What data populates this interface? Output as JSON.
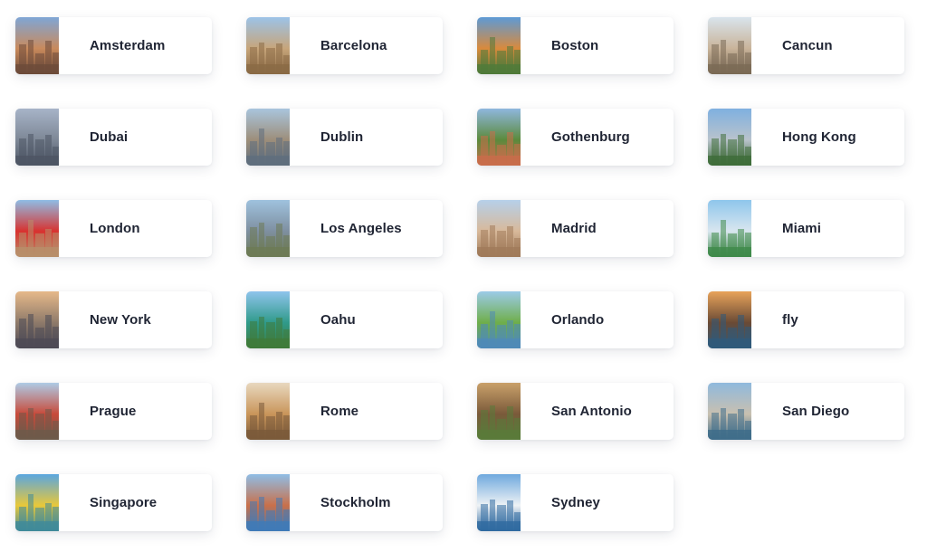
{
  "destinations": [
    {
      "name": "Amsterdam",
      "icon": "amsterdam-photo",
      "colors": [
        "#7fa6d6",
        "#c98a5c",
        "#6d4b3a"
      ]
    },
    {
      "name": "Barcelona",
      "icon": "barcelona-photo",
      "colors": [
        "#9cc3e8",
        "#c7a57a",
        "#8a6a45"
      ]
    },
    {
      "name": "Boston",
      "icon": "boston-photo",
      "colors": [
        "#5d9ad6",
        "#d98a3c",
        "#4f7a3a"
      ]
    },
    {
      "name": "Cancun",
      "icon": "cancun-photo",
      "colors": [
        "#d9e4ec",
        "#c9b49a",
        "#7a6a55"
      ]
    },
    {
      "name": "Dubai",
      "icon": "dubai-photo",
      "colors": [
        "#a7b4c8",
        "#7d8796",
        "#4d5564"
      ]
    },
    {
      "name": "Dublin",
      "icon": "dublin-photo",
      "colors": [
        "#a9c5dd",
        "#9d8e7a",
        "#5f6e7d"
      ]
    },
    {
      "name": "Gothenburg",
      "icon": "gothenburg-photo",
      "colors": [
        "#8fb7de",
        "#5b8a3c",
        "#c96d4b"
      ]
    },
    {
      "name": "Hong Kong",
      "icon": "hong-kong-photo",
      "colors": [
        "#7fb0e0",
        "#b9c3cc",
        "#3f6d3a"
      ]
    },
    {
      "name": "London",
      "icon": "london-photo",
      "colors": [
        "#8fbde6",
        "#d8322f",
        "#b88e6a"
      ]
    },
    {
      "name": "Los Angeles",
      "icon": "los-angeles-photo",
      "colors": [
        "#9fc2de",
        "#7e8fa0",
        "#6d7a55"
      ]
    },
    {
      "name": "Madrid",
      "icon": "madrid-photo",
      "colors": [
        "#b6d0ea",
        "#d8b99a",
        "#a07a5a"
      ]
    },
    {
      "name": "Miami",
      "icon": "miami-photo",
      "colors": [
        "#8ec6ec",
        "#d9e6ef",
        "#3f8a4a"
      ]
    },
    {
      "name": "New York",
      "icon": "new-york-photo",
      "colors": [
        "#e6b98a",
        "#8e7a6a",
        "#4d4a55"
      ]
    },
    {
      "name": "Oahu",
      "icon": "oahu-photo",
      "colors": [
        "#8fc4ec",
        "#2f9a8a",
        "#3f7a3a"
      ]
    },
    {
      "name": "Orlando",
      "icon": "orlando-photo",
      "colors": [
        "#9ccbe8",
        "#6fae4a",
        "#4f8ab8"
      ]
    },
    {
      "name": "fly",
      "icon": "paris-photo",
      "colors": [
        "#e8a35a",
        "#6a4a35",
        "#2f5a7a"
      ]
    },
    {
      "name": "Prague",
      "icon": "prague-photo",
      "colors": [
        "#aecbe6",
        "#c84a3a",
        "#6e5a4a"
      ]
    },
    {
      "name": "Rome",
      "icon": "rome-photo",
      "colors": [
        "#e8d8bf",
        "#c9955a",
        "#7a5a3a"
      ]
    },
    {
      "name": "San Antonio",
      "icon": "san-antonio-photo",
      "colors": [
        "#c9a06a",
        "#7a5a3a",
        "#5a7a3a"
      ]
    },
    {
      "name": "San Diego",
      "icon": "san-diego-photo",
      "colors": [
        "#8fb9dd",
        "#c9c0b0",
        "#3f6d8a"
      ]
    },
    {
      "name": "Singapore",
      "icon": "singapore-photo",
      "colors": [
        "#5aa6e0",
        "#e8c83a",
        "#3f8a9a"
      ]
    },
    {
      "name": "Stockholm",
      "icon": "stockholm-photo",
      "colors": [
        "#8fbde6",
        "#c9704a",
        "#3f7ab8"
      ]
    },
    {
      "name": "Sydney",
      "icon": "sydney-photo",
      "colors": [
        "#6fa9de",
        "#eef2f5",
        "#2f6aa0"
      ]
    }
  ]
}
